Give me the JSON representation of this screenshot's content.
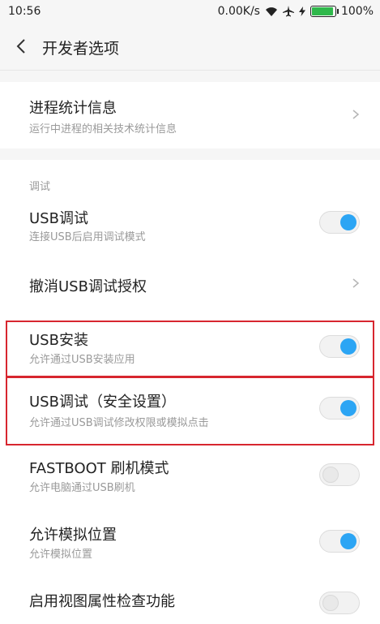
{
  "statusbar": {
    "time": "10:56",
    "speed": "0.00K/s",
    "battery": "100%",
    "battery_level": 1.0
  },
  "header": {
    "title": "开发者选项"
  },
  "rows": {
    "process_stats": {
      "label": "进程统计信息",
      "desc": "运行中进程的相关技术统计信息"
    },
    "section_debug": "调试",
    "usb_debug": {
      "label": "USB调试",
      "desc": "连接USB后启用调试模式",
      "on": true
    },
    "revoke_usb": {
      "label": "撤消USB调试授权"
    },
    "usb_install": {
      "label": "USB安装",
      "desc": "允许通过USB安装应用",
      "on": true
    },
    "usb_debug_secure": {
      "label": "USB调试（安全设置）",
      "desc": "允许通过USB调试修改权限或模拟点击",
      "on": true
    },
    "fastboot": {
      "label": "FASTBOOT 刷机模式",
      "desc": "允许电脑通过USB刷机",
      "on": false
    },
    "mock_location": {
      "label": "允许模拟位置",
      "desc": "允许模拟位置",
      "on": true
    },
    "view_attr": {
      "label": "启用视图属性检查功能",
      "on": false
    }
  },
  "colors": {
    "accent": "#2ca5f4",
    "highlight": "#d7262f"
  }
}
